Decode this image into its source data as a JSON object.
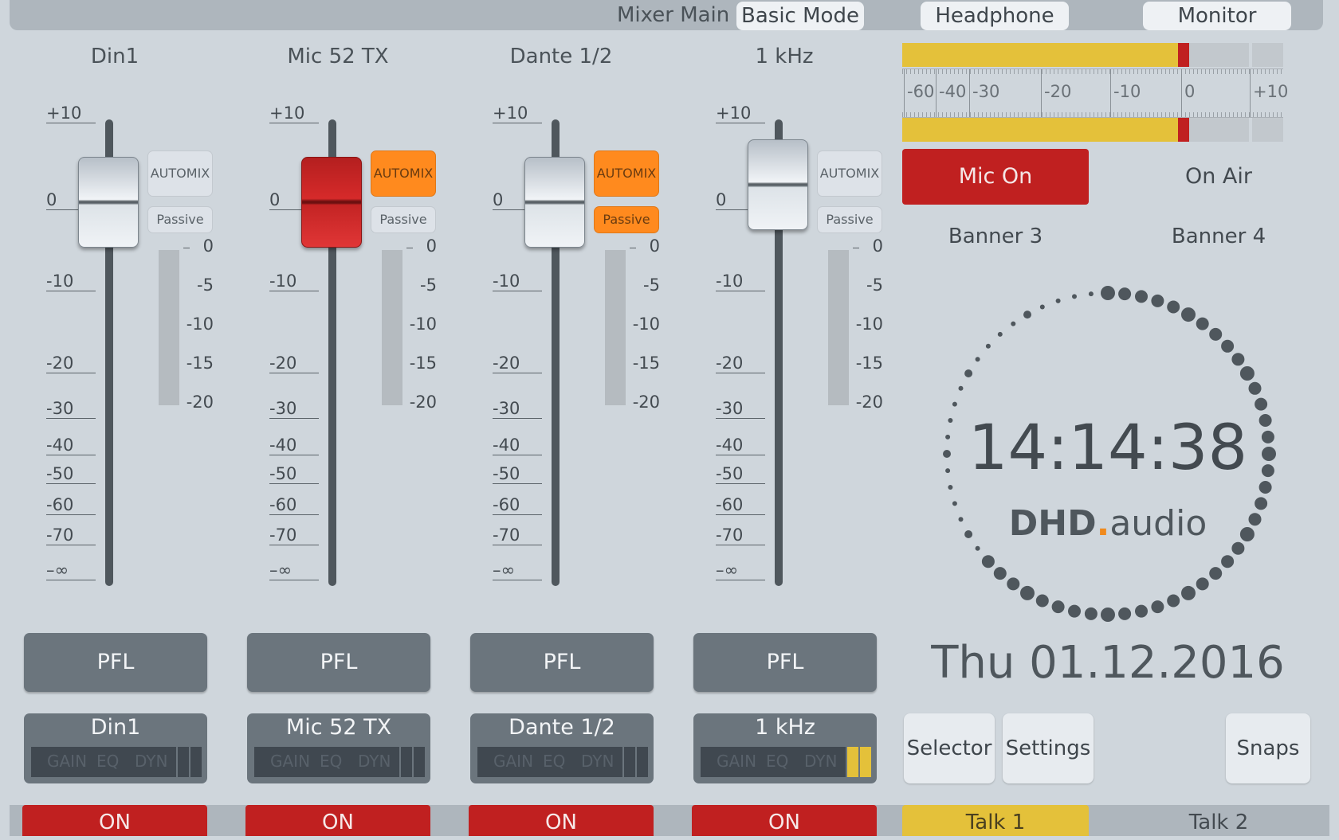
{
  "header": {
    "title": "Mixer Main",
    "mode_button": "Basic Mode",
    "headphone": "Headphone",
    "monitor": "Monitor"
  },
  "fader_scale": [
    "+10",
    "0",
    "-10",
    "-20",
    "-30",
    "-40",
    "-50",
    "-60",
    "-70",
    "–∞"
  ],
  "meter_scale": [
    "0",
    "-5",
    "-10",
    "-15",
    "-20"
  ],
  "channels": [
    {
      "name": "Din1",
      "automix": "AUTOMIX",
      "passive": "Passive",
      "pfl": "PFL",
      "on": "ON",
      "fader_db": 0,
      "knob_style": "gray",
      "automix_active": false,
      "passive_active": false,
      "strip_meter_active": false
    },
    {
      "name": "Mic 52  TX",
      "automix": "AUTOMIX",
      "passive": "Passive",
      "pfl": "PFL",
      "on": "ON",
      "fader_db": 0,
      "knob_style": "red",
      "automix_active": true,
      "passive_active": false,
      "strip_meter_active": false
    },
    {
      "name": "Dante 1/2",
      "automix": "AUTOMIX",
      "passive": "Passive",
      "pfl": "PFL",
      "on": "ON",
      "fader_db": 0,
      "knob_style": "gray",
      "automix_active": true,
      "passive_active": true,
      "strip_meter_active": false
    },
    {
      "name": "1 kHz",
      "automix": "AUTOMIX",
      "passive": "Passive",
      "pfl": "PFL",
      "on": "ON",
      "fader_db": 2,
      "knob_style": "gray",
      "automix_active": false,
      "passive_active": false,
      "strip_meter_active": true
    }
  ],
  "strip_tabs": [
    "GAIN",
    "EQ",
    "DYN"
  ],
  "level_meter": {
    "scale": [
      "-60",
      "-40",
      "-30",
      "-20",
      "-10",
      "0",
      "+10"
    ],
    "left_level_db": -0.5,
    "right_level_db": -0.5
  },
  "status": {
    "mic_on": "Mic On",
    "on_air": "On Air",
    "banner3": "Banner 3",
    "banner4": "Banner 4"
  },
  "clock": {
    "time": "14:14:38",
    "seconds": 38,
    "brand_main": "DHD",
    "brand_dot": ".",
    "brand_suffix": "audio",
    "date": "Thu 01.12.2016"
  },
  "buttons": {
    "selector": "Selector",
    "settings": "Settings",
    "snaps": "Snaps",
    "talk1": "Talk 1",
    "talk2": "Talk 2"
  },
  "colors": {
    "background": "#cfd6dc",
    "red": "#c02020",
    "orange": "#ff8a1e",
    "yellow": "#e4c13a",
    "brand_dot": "#f08a1e"
  }
}
